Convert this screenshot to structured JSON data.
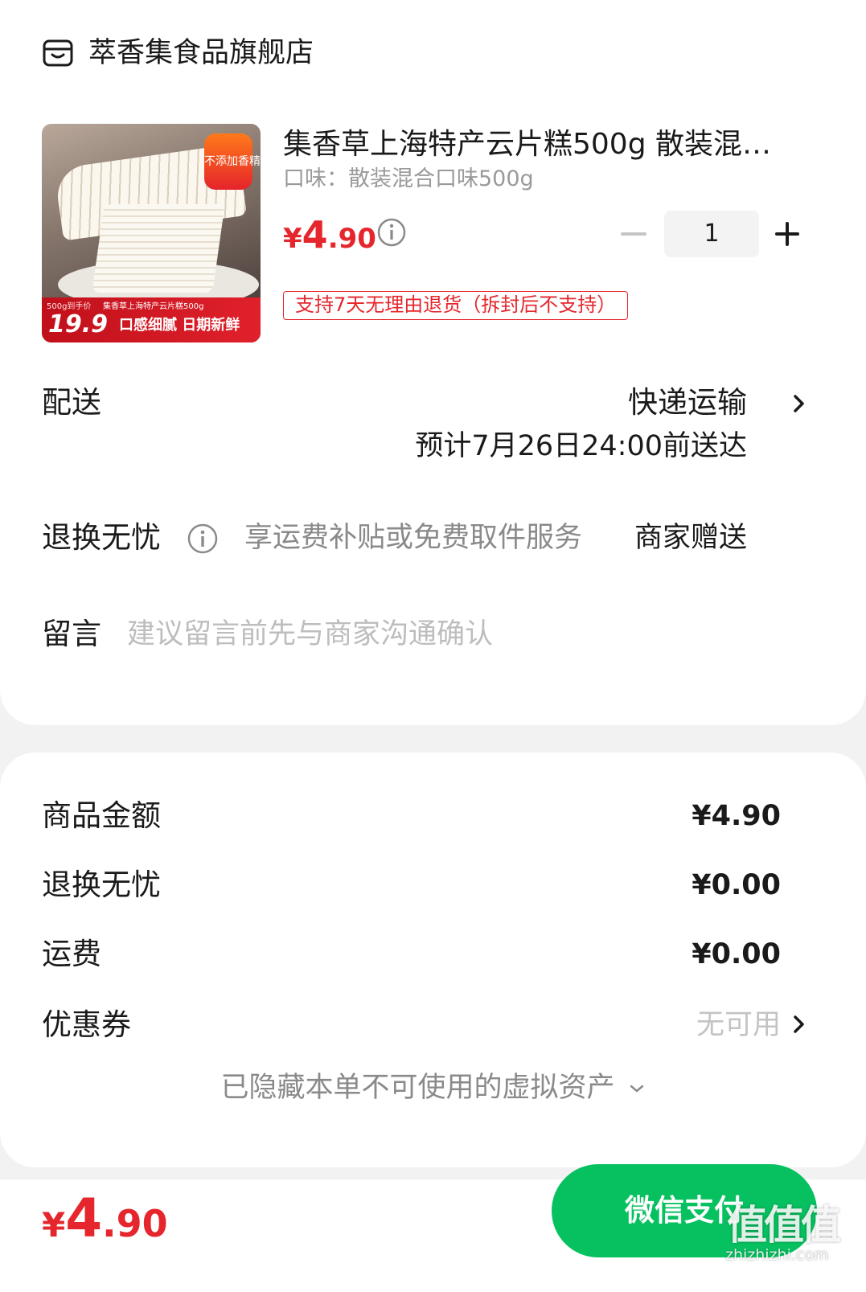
{
  "store": {
    "name": "萃香集食品旗舰店",
    "icon": "store-icon"
  },
  "product": {
    "title": "集香草上海特产云片糕500g 散装混…",
    "variant": "口味：散装混合口味500g",
    "price": {
      "symbol": "¥",
      "integer": "4",
      "decimal": ".90"
    },
    "quantity": "1",
    "return_policy": "支持7天无理由退货（拆封后不支持）",
    "image": {
      "badge": "不添加香精",
      "banner_price_label": "500g到手价",
      "banner_price": "19.9",
      "banner_product": "集香草上海特产云片糕500g",
      "banner_slogan": "口感细腻 日期新鲜"
    }
  },
  "shipping": {
    "label": "配送",
    "method": "快递运输",
    "eta": "预计7月26日24:00前送达"
  },
  "worry_free": {
    "label": "退换无忧",
    "description": "享运费补贴或免费取件服务",
    "gift": "商家赠送"
  },
  "note": {
    "label": "留言",
    "placeholder": "建议留言前先与商家沟通确认"
  },
  "summary": {
    "goods_label": "商品金额",
    "goods_value": "¥4.90",
    "worry_label": "退换无忧",
    "worry_value": "¥0.00",
    "shipping_label": "运费",
    "shipping_value": "¥0.00",
    "coupon_label": "优惠券",
    "coupon_value": "无可用",
    "hidden_assets": "已隐藏本单不可使用的虚拟资产"
  },
  "footer": {
    "total": {
      "symbol": "¥",
      "integer": "4",
      "decimal": ".90"
    },
    "pay_label": "微信支付"
  },
  "watermark": {
    "text": "值值值",
    "url": "zhizhizhi.com"
  },
  "colors": {
    "accent_red": "#e5262c",
    "wechat_green": "#07c160",
    "background": "#f2f2f2"
  }
}
